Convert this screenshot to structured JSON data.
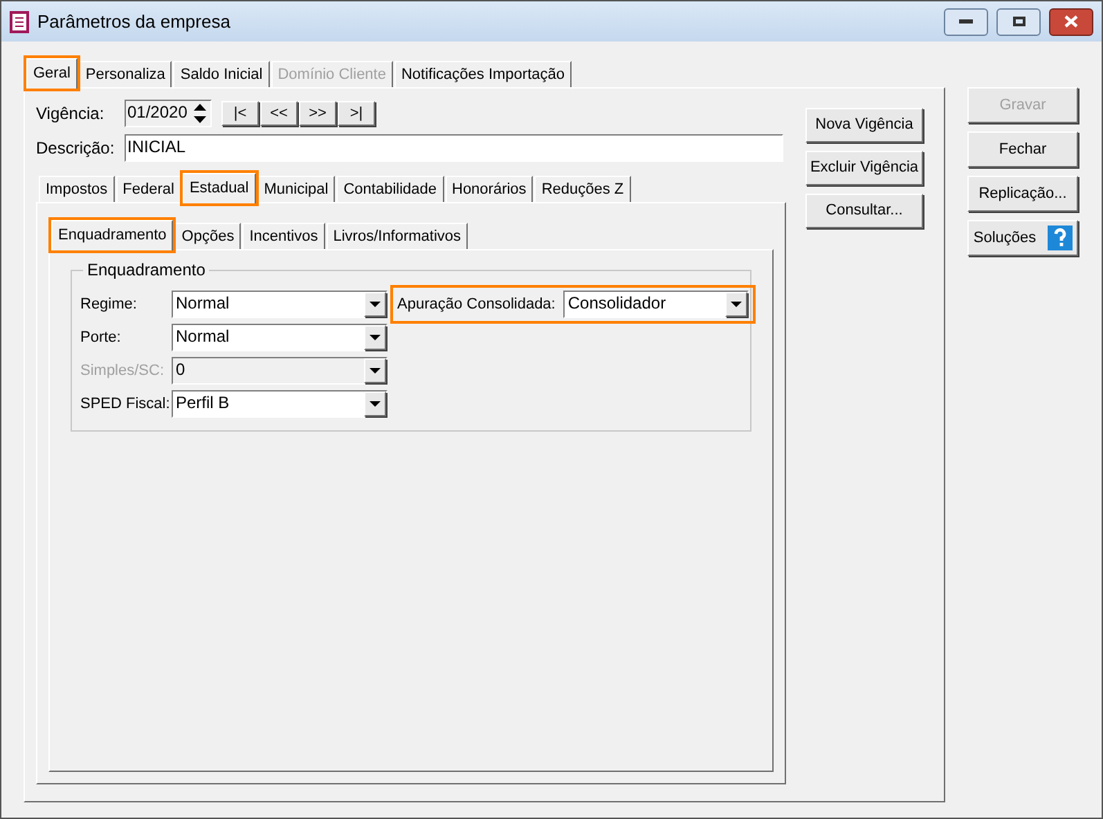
{
  "window": {
    "title": "Parâmetros da empresa"
  },
  "tabs": [
    {
      "label": "Geral",
      "selected": true,
      "disabled": false,
      "highlighted": true
    },
    {
      "label": "Personaliza",
      "selected": false,
      "disabled": false,
      "highlighted": false
    },
    {
      "label": "Saldo Inicial",
      "selected": false,
      "disabled": false,
      "highlighted": false
    },
    {
      "label": "Domínio Cliente",
      "selected": false,
      "disabled": true,
      "highlighted": false
    },
    {
      "label": "Notificações Importação",
      "selected": false,
      "disabled": false,
      "highlighted": false
    }
  ],
  "vigencia": {
    "label": "Vigência:",
    "value": "01/2020",
    "nav_buttons": [
      "|<",
      "<<",
      ">>",
      ">|"
    ]
  },
  "descricao": {
    "label": "Descrição:",
    "value": "INICIAL"
  },
  "vigencia_buttons": [
    "Nova Vigência",
    "Excluir Vigência",
    "Consultar..."
  ],
  "sub_tabs": [
    {
      "label": "Impostos",
      "selected": false,
      "highlighted": false
    },
    {
      "label": "Federal",
      "selected": false,
      "highlighted": false
    },
    {
      "label": "Estadual",
      "selected": true,
      "highlighted": true
    },
    {
      "label": "Municipal",
      "selected": false,
      "highlighted": false
    },
    {
      "label": "Contabilidade",
      "selected": false,
      "highlighted": false
    },
    {
      "label": "Honorários",
      "selected": false,
      "highlighted": false
    },
    {
      "label": "Reduções Z",
      "selected": false,
      "highlighted": false
    }
  ],
  "inner_tabs": [
    {
      "label": "Enquadramento",
      "selected": true,
      "highlighted": true
    },
    {
      "label": "Opções",
      "selected": false,
      "highlighted": false
    },
    {
      "label": "Incentivos",
      "selected": false,
      "highlighted": false
    },
    {
      "label": "Livros/Informativos",
      "selected": false,
      "highlighted": false
    }
  ],
  "group": {
    "title": "Enquadramento",
    "fields": [
      {
        "label": "Regime:",
        "value": "Normal",
        "disabled": false
      },
      {
        "label": "Porte:",
        "value": "Normal",
        "disabled": false
      },
      {
        "label": "Simples/SC:",
        "value": "0",
        "disabled": true
      },
      {
        "label": "SPED Fiscal:",
        "value": "Perfil B",
        "disabled": false
      }
    ],
    "consolidada": {
      "label": "Apuração Consolidada:",
      "value": "Consolidador",
      "highlighted": true
    }
  },
  "side_buttons": [
    {
      "label": "Gravar",
      "disabled": true,
      "kind": "plain"
    },
    {
      "label": "Fechar",
      "disabled": false,
      "kind": "plain"
    },
    {
      "label": "Replicação...",
      "disabled": false,
      "kind": "plain"
    },
    {
      "label": "Soluções",
      "disabled": false,
      "kind": "help"
    }
  ]
}
